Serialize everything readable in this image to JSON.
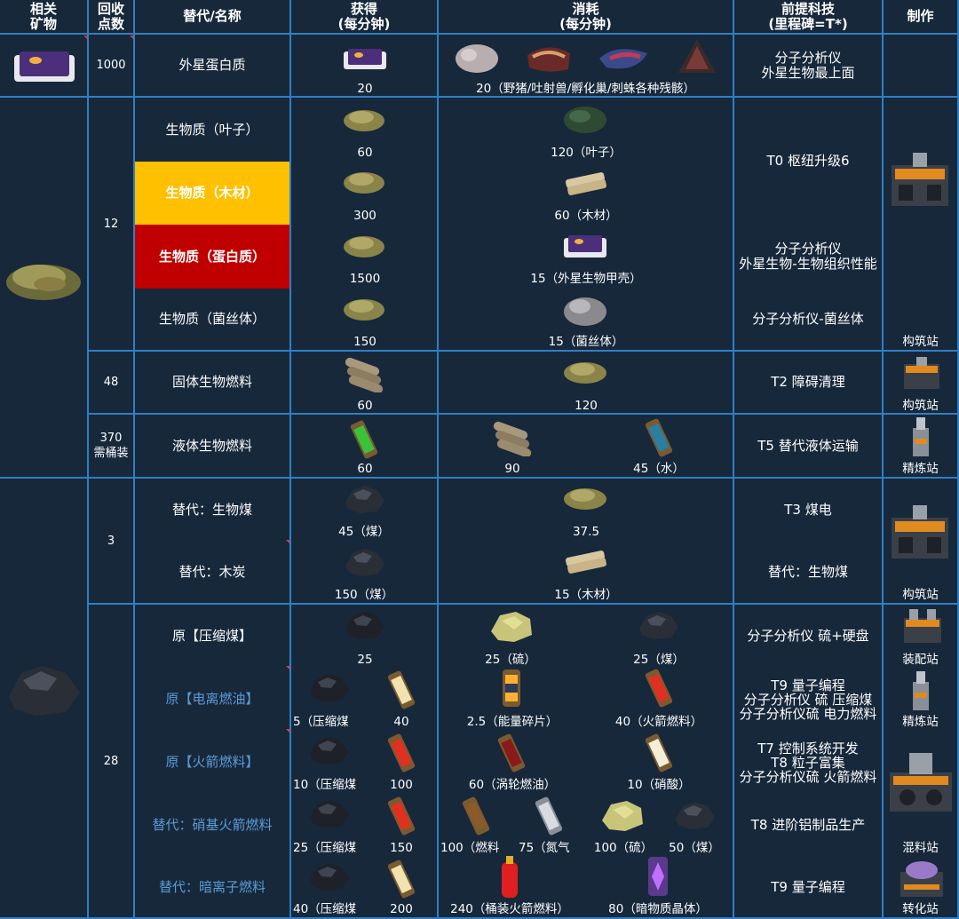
{
  "headers": {
    "related_ore": "相关\n矿物",
    "recycle_points": "回收\n点数",
    "alt_name": "替代/名称",
    "obtain": "获得\n(每分钟)",
    "consume": "消耗\n(每分钟)",
    "prereq": "前提科技\n(里程碑=T*)",
    "craft": "制作"
  },
  "colors": {
    "accent_line": "#2f7fc4",
    "bg": "#17283b",
    "highlight_yellow": "#ffc000",
    "highlight_red": "#c00000",
    "alt_blue": "#5b9bd5"
  },
  "rows": {
    "alien_protein": {
      "points": "1000",
      "name": "外星蛋白质",
      "obtain_qty": "20",
      "consume_text": "20（野猪/吐射兽/孵化巢/刺蛛各种残骸）",
      "prereq": "分子分析仪\n外星生物最上面"
    },
    "biomass_group_points": "12",
    "biomass_leaf": {
      "name": "生物质（叶子）",
      "obtain_qty": "60",
      "consume": "120（叶子）",
      "prereq": "T0 枢纽升级6"
    },
    "biomass_wood": {
      "name": "生物质（木材）",
      "obtain_qty": "300",
      "consume": "60（木材）"
    },
    "biomass_protein": {
      "name": "生物质（蛋白质）",
      "obtain_qty": "1500",
      "consume": "15（外星生物甲壳）",
      "prereq": "分子分析仪\n外星生物-生物组织性能"
    },
    "biomass_mycelia": {
      "name": "生物质（菌丝体）",
      "obtain_qty": "150",
      "consume": "15（菌丝体）",
      "prereq": "分子分析仪-菌丝体"
    },
    "biomass_craft": "构筑站",
    "solid_biofuel": {
      "points": "48",
      "name": "固体生物燃料",
      "obtain_qty": "60",
      "consume": "120",
      "prereq": "T2 障碍清理",
      "craft": "构筑站"
    },
    "liquid_biofuel": {
      "points": "370\n需桶装",
      "name": "液体生物燃料",
      "obtain_qty": "60",
      "consume_a": "90",
      "consume_b": "45（水）",
      "prereq": "T5 替代液体运输",
      "craft": "精炼站"
    },
    "coal_group_points": "3",
    "biocoal": {
      "name": "替代：生物煤",
      "obtain_qty": "45（煤）",
      "consume": "37.5",
      "prereq": "T3 煤电"
    },
    "charcoal": {
      "name": "替代：木炭",
      "obtain_qty": "150（煤）",
      "consume": "15（木材）",
      "prereq": "替代：生物煤"
    },
    "coal_craft": "构筑站",
    "compacted_group_points": "28",
    "compacted_coal": {
      "name": "原【压缩煤】",
      "obtain_qty": "25",
      "consume_a": "25（硫）",
      "consume_b": "25（煤）",
      "prereq": "分子分析仪 硫+硬盘",
      "craft": "装配站"
    },
    "ionized_fuel": {
      "name": "原【电离燃油】",
      "obtain_a": "5（压缩煤",
      "obtain_b": "40",
      "consume_a": "2.5（能量碎片）",
      "consume_b": "40（火箭燃料）",
      "prereq": "T9 量子编程\n分子分析仪 硫 压缩煤\n分子分析仪硫 电力燃料",
      "craft": "精炼站"
    },
    "rocket_fuel": {
      "name": "原【火箭燃料】",
      "obtain_a": "10（压缩煤",
      "obtain_b": "100",
      "consume_a": "60（涡轮燃油）",
      "consume_b": "10（硝酸）",
      "prereq": "T7 控制系统开发\nT8 粒子富集\n分子分析仪硫 火箭燃料"
    },
    "nitro_rocket_fuel": {
      "name": "替代：硝基火箭燃料",
      "obtain_a": "25（压缩煤",
      "obtain_b": "150",
      "consume_a": "100（燃料",
      "consume_b": "75（氮气",
      "consume_c": "100（硫）",
      "consume_d": "50（煤）",
      "prereq": "T8 进阶铝制品生产",
      "craft": "混料站"
    },
    "dark_ion_fuel": {
      "name": "替代：暗离子燃料",
      "obtain_a": "40（压缩煤",
      "obtain_b": "200",
      "consume_a": "240（桶装火箭燃料）",
      "consume_b": "80（暗物质晶体）",
      "prereq": "T9 量子编程",
      "craft": "转化站"
    }
  },
  "icons": [
    "alien-protein-icon",
    "boar-remains-icon",
    "spitter-remains-icon",
    "hatcher-remains-icon",
    "stinger-remains-icon",
    "biomass-icon",
    "leaves-icon",
    "wood-icon",
    "alien-carapace-icon",
    "mycelia-icon",
    "solid-biofuel-icon",
    "liquid-biofuel-icon",
    "water-canister-icon",
    "compacted-coal-icon",
    "coal-icon",
    "sulfur-icon",
    "ionized-fuel-icon",
    "rocket-fuel-icon",
    "power-shard-icon",
    "turbofuel-icon",
    "nitric-acid-icon",
    "nitrogen-icon",
    "packaged-rocket-fuel-icon",
    "dark-matter-crystal-icon",
    "constructor-icon",
    "refinery-icon",
    "assembler-icon",
    "blender-icon",
    "converter-icon"
  ]
}
